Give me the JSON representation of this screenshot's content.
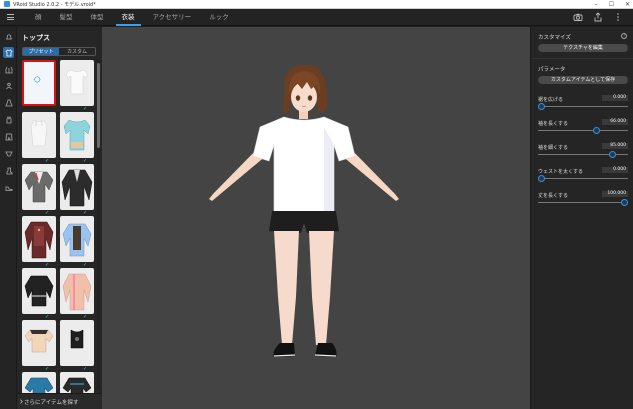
{
  "window": {
    "title": "VRoid Studio 2.0.2 - モデル.vroid*"
  },
  "tabs": [
    {
      "label": "顔"
    },
    {
      "label": "髪型"
    },
    {
      "label": "体型"
    },
    {
      "label": "衣装"
    },
    {
      "label": "アクセサリー"
    },
    {
      "label": "ルック"
    }
  ],
  "active_tab": "衣装",
  "left_panel": {
    "title": "トップス",
    "segments": [
      "プリセット",
      "カスタム"
    ],
    "active_segment": "プリセット",
    "more_items_label": "さらにアイテムを探す",
    "checkmark": "✓"
  },
  "right_panel": {
    "customize_label": "カスタマイズ",
    "edit_texture_button": "テクスチャを編集",
    "parameters_label": "パラメータ",
    "save_custom_button": "カスタムアイテムとして保存",
    "help_glyph": "?",
    "params": [
      {
        "name": "裾を広げる",
        "value": "0.000",
        "fraction": 0.0
      },
      {
        "name": "袖を長くする",
        "value": "66.000",
        "fraction": 0.66
      },
      {
        "name": "袖を細くする",
        "value": "85.000",
        "fraction": 0.85
      },
      {
        "name": "ウェストを太くする",
        "value": "0.000",
        "fraction": 0.0
      },
      {
        "name": "丈を長くする",
        "value": "100.000",
        "fraction": 1.0
      }
    ]
  },
  "colors": {
    "accent": "#3aa0f0",
    "viewport_bg": "#444444",
    "selection": "#dd1111"
  }
}
